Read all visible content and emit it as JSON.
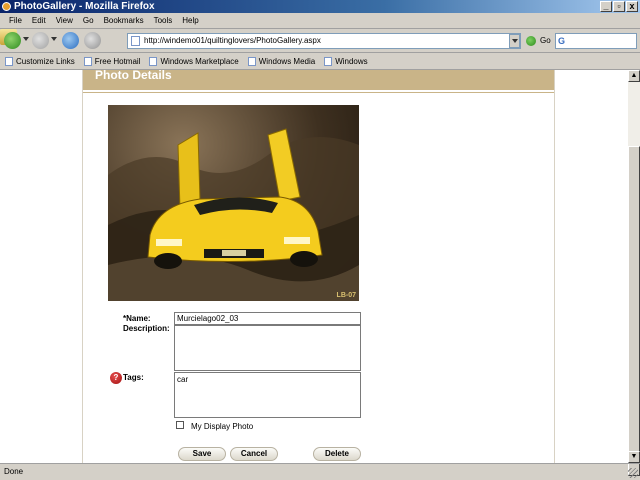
{
  "window": {
    "title": "PhotoGallery - Mozilla Firefox",
    "controls": [
      "_",
      "▫",
      "x"
    ]
  },
  "menu": [
    "File",
    "Edit",
    "View",
    "Go",
    "Bookmarks",
    "Tools",
    "Help"
  ],
  "address": {
    "url": "http://windemo01/quiltinglovers/PhotoGallery.aspx",
    "go_label": "Go"
  },
  "bookmarks": [
    "Customize Links",
    "Free Hotmail",
    "Windows Marketplace",
    "Windows Media",
    "Windows"
  ],
  "panel": {
    "title": "Photo Details"
  },
  "photo": {
    "corner_mark": "LB-07"
  },
  "form": {
    "name_label": "*Name:",
    "name_value": "Murcielago02_03",
    "description_label": "Description:",
    "description_value": "",
    "tags_label": "Tags:",
    "tags_value": "car",
    "help_glyph": "?",
    "display_photo_label": "My Display Photo",
    "display_photo_checked": false
  },
  "buttons": {
    "save": "Save",
    "cancel": "Cancel",
    "delete": "Delete"
  },
  "status": {
    "text": "Done"
  },
  "icons": {
    "back": "back-arrow-icon",
    "forward": "forward-arrow-icon",
    "reload": "reload-icon",
    "stop": "stop-icon",
    "home": "home-icon",
    "go": "go-icon",
    "search": "google-search-icon",
    "bookmark": "bookmark-page-icon",
    "help": "help-icon"
  }
}
